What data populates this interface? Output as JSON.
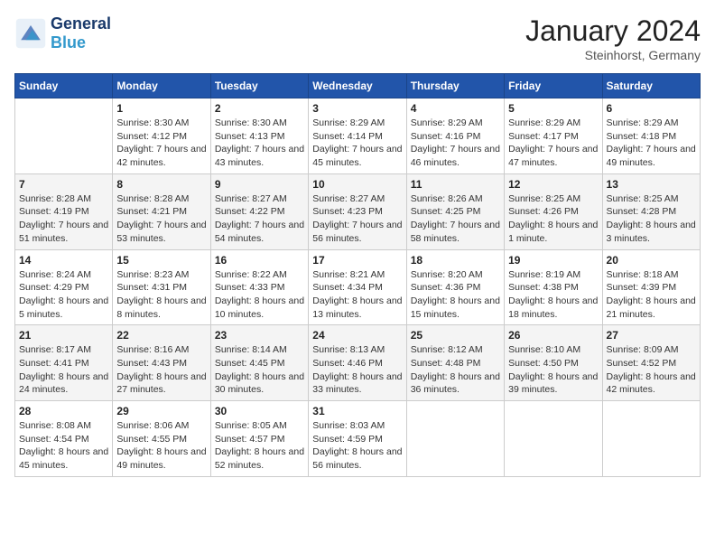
{
  "header": {
    "logo_general": "General",
    "logo_blue": "Blue",
    "month_title": "January 2024",
    "location": "Steinhorst, Germany"
  },
  "weekdays": [
    "Sunday",
    "Monday",
    "Tuesday",
    "Wednesday",
    "Thursday",
    "Friday",
    "Saturday"
  ],
  "weeks": [
    [
      {
        "day": "",
        "sunrise": "",
        "sunset": "",
        "daylight": ""
      },
      {
        "day": "1",
        "sunrise": "Sunrise: 8:30 AM",
        "sunset": "Sunset: 4:12 PM",
        "daylight": "Daylight: 7 hours and 42 minutes."
      },
      {
        "day": "2",
        "sunrise": "Sunrise: 8:30 AM",
        "sunset": "Sunset: 4:13 PM",
        "daylight": "Daylight: 7 hours and 43 minutes."
      },
      {
        "day": "3",
        "sunrise": "Sunrise: 8:29 AM",
        "sunset": "Sunset: 4:14 PM",
        "daylight": "Daylight: 7 hours and 45 minutes."
      },
      {
        "day": "4",
        "sunrise": "Sunrise: 8:29 AM",
        "sunset": "Sunset: 4:16 PM",
        "daylight": "Daylight: 7 hours and 46 minutes."
      },
      {
        "day": "5",
        "sunrise": "Sunrise: 8:29 AM",
        "sunset": "Sunset: 4:17 PM",
        "daylight": "Daylight: 7 hours and 47 minutes."
      },
      {
        "day": "6",
        "sunrise": "Sunrise: 8:29 AM",
        "sunset": "Sunset: 4:18 PM",
        "daylight": "Daylight: 7 hours and 49 minutes."
      }
    ],
    [
      {
        "day": "7",
        "sunrise": "Sunrise: 8:28 AM",
        "sunset": "Sunset: 4:19 PM",
        "daylight": "Daylight: 7 hours and 51 minutes."
      },
      {
        "day": "8",
        "sunrise": "Sunrise: 8:28 AM",
        "sunset": "Sunset: 4:21 PM",
        "daylight": "Daylight: 7 hours and 53 minutes."
      },
      {
        "day": "9",
        "sunrise": "Sunrise: 8:27 AM",
        "sunset": "Sunset: 4:22 PM",
        "daylight": "Daylight: 7 hours and 54 minutes."
      },
      {
        "day": "10",
        "sunrise": "Sunrise: 8:27 AM",
        "sunset": "Sunset: 4:23 PM",
        "daylight": "Daylight: 7 hours and 56 minutes."
      },
      {
        "day": "11",
        "sunrise": "Sunrise: 8:26 AM",
        "sunset": "Sunset: 4:25 PM",
        "daylight": "Daylight: 7 hours and 58 minutes."
      },
      {
        "day": "12",
        "sunrise": "Sunrise: 8:25 AM",
        "sunset": "Sunset: 4:26 PM",
        "daylight": "Daylight: 8 hours and 1 minute."
      },
      {
        "day": "13",
        "sunrise": "Sunrise: 8:25 AM",
        "sunset": "Sunset: 4:28 PM",
        "daylight": "Daylight: 8 hours and 3 minutes."
      }
    ],
    [
      {
        "day": "14",
        "sunrise": "Sunrise: 8:24 AM",
        "sunset": "Sunset: 4:29 PM",
        "daylight": "Daylight: 8 hours and 5 minutes."
      },
      {
        "day": "15",
        "sunrise": "Sunrise: 8:23 AM",
        "sunset": "Sunset: 4:31 PM",
        "daylight": "Daylight: 8 hours and 8 minutes."
      },
      {
        "day": "16",
        "sunrise": "Sunrise: 8:22 AM",
        "sunset": "Sunset: 4:33 PM",
        "daylight": "Daylight: 8 hours and 10 minutes."
      },
      {
        "day": "17",
        "sunrise": "Sunrise: 8:21 AM",
        "sunset": "Sunset: 4:34 PM",
        "daylight": "Daylight: 8 hours and 13 minutes."
      },
      {
        "day": "18",
        "sunrise": "Sunrise: 8:20 AM",
        "sunset": "Sunset: 4:36 PM",
        "daylight": "Daylight: 8 hours and 15 minutes."
      },
      {
        "day": "19",
        "sunrise": "Sunrise: 8:19 AM",
        "sunset": "Sunset: 4:38 PM",
        "daylight": "Daylight: 8 hours and 18 minutes."
      },
      {
        "day": "20",
        "sunrise": "Sunrise: 8:18 AM",
        "sunset": "Sunset: 4:39 PM",
        "daylight": "Daylight: 8 hours and 21 minutes."
      }
    ],
    [
      {
        "day": "21",
        "sunrise": "Sunrise: 8:17 AM",
        "sunset": "Sunset: 4:41 PM",
        "daylight": "Daylight: 8 hours and 24 minutes."
      },
      {
        "day": "22",
        "sunrise": "Sunrise: 8:16 AM",
        "sunset": "Sunset: 4:43 PM",
        "daylight": "Daylight: 8 hours and 27 minutes."
      },
      {
        "day": "23",
        "sunrise": "Sunrise: 8:14 AM",
        "sunset": "Sunset: 4:45 PM",
        "daylight": "Daylight: 8 hours and 30 minutes."
      },
      {
        "day": "24",
        "sunrise": "Sunrise: 8:13 AM",
        "sunset": "Sunset: 4:46 PM",
        "daylight": "Daylight: 8 hours and 33 minutes."
      },
      {
        "day": "25",
        "sunrise": "Sunrise: 8:12 AM",
        "sunset": "Sunset: 4:48 PM",
        "daylight": "Daylight: 8 hours and 36 minutes."
      },
      {
        "day": "26",
        "sunrise": "Sunrise: 8:10 AM",
        "sunset": "Sunset: 4:50 PM",
        "daylight": "Daylight: 8 hours and 39 minutes."
      },
      {
        "day": "27",
        "sunrise": "Sunrise: 8:09 AM",
        "sunset": "Sunset: 4:52 PM",
        "daylight": "Daylight: 8 hours and 42 minutes."
      }
    ],
    [
      {
        "day": "28",
        "sunrise": "Sunrise: 8:08 AM",
        "sunset": "Sunset: 4:54 PM",
        "daylight": "Daylight: 8 hours and 45 minutes."
      },
      {
        "day": "29",
        "sunrise": "Sunrise: 8:06 AM",
        "sunset": "Sunset: 4:55 PM",
        "daylight": "Daylight: 8 hours and 49 minutes."
      },
      {
        "day": "30",
        "sunrise": "Sunrise: 8:05 AM",
        "sunset": "Sunset: 4:57 PM",
        "daylight": "Daylight: 8 hours and 52 minutes."
      },
      {
        "day": "31",
        "sunrise": "Sunrise: 8:03 AM",
        "sunset": "Sunset: 4:59 PM",
        "daylight": "Daylight: 8 hours and 56 minutes."
      },
      {
        "day": "",
        "sunrise": "",
        "sunset": "",
        "daylight": ""
      },
      {
        "day": "",
        "sunrise": "",
        "sunset": "",
        "daylight": ""
      },
      {
        "day": "",
        "sunrise": "",
        "sunset": "",
        "daylight": ""
      }
    ]
  ]
}
